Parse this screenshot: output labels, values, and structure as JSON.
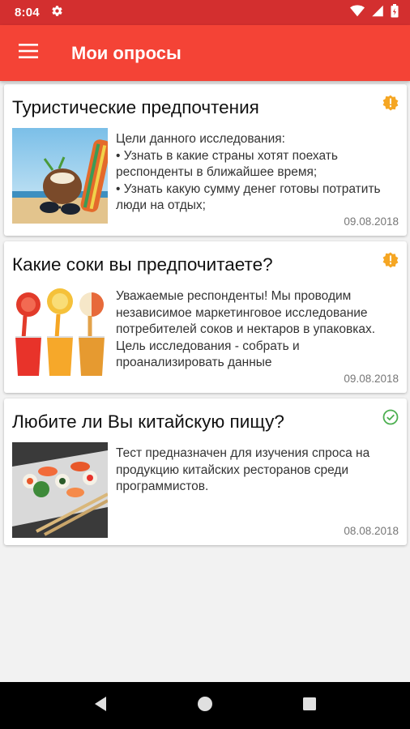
{
  "status_bar": {
    "time": "8:04",
    "icons": [
      "settings-gear-icon",
      "wifi-icon",
      "signal-icon",
      "battery-icon"
    ]
  },
  "app_bar": {
    "title": "Мои опросы",
    "menu_icon": "hamburger-menu-icon",
    "color": "#f44336"
  },
  "surveys": [
    {
      "title": "Туристические предпочтения",
      "description": "Цели данного исследования:\n• Узнать в какие страны хотят поехать респонденты в ближайшее время;\n• Узнать какую сумму денег готовы потратить люди на отдых;",
      "date": "09.08.2018",
      "status_icon": "pending-warning-icon",
      "status_color": "#f5a623",
      "image": "beach-coconut-sunglasses-image"
    },
    {
      "title": "Какие соки вы предпочитаете?",
      "description": "Уважаемые респонденты! Мы проводим независимое маркетинговое исследование потребителей соков и нектаров в упаковках. Цель исследования - собрать и проанализировать данные",
      "date": "09.08.2018",
      "status_icon": "pending-warning-icon",
      "status_color": "#f5a623",
      "image": "juice-glasses-image"
    },
    {
      "title": "Любите ли Вы китайскую пищу?",
      "description": "Тест предназначен для изучения спроса на продукцию китайских ресторанов среди программистов.",
      "date": "08.08.2018",
      "status_icon": "completed-check-icon",
      "status_color": "#4caf50",
      "image": "sushi-chopsticks-image"
    }
  ],
  "nav_bar": {
    "icons": [
      "back-icon",
      "home-icon",
      "recents-icon"
    ]
  }
}
